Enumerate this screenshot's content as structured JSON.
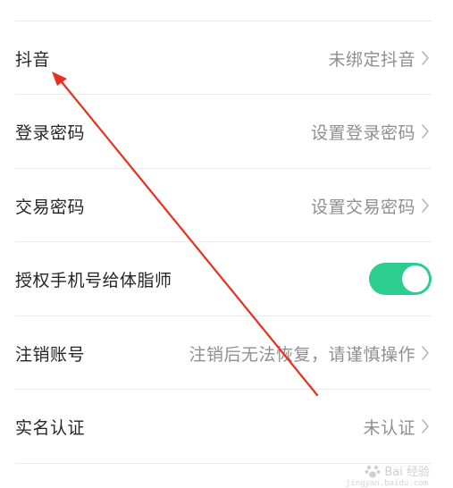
{
  "settings": {
    "rows": [
      {
        "label": "抖音",
        "value": "未绑定抖音"
      },
      {
        "label": "登录密码",
        "value": "设置登录密码"
      },
      {
        "label": "交易密码",
        "value": "设置交易密码"
      },
      {
        "label": "授权手机号给体脂师",
        "toggle_on": true
      },
      {
        "label": "注销账号",
        "value": "注销后无法恢复，请谨慎操作"
      },
      {
        "label": "实名认证",
        "value": "未认证"
      }
    ]
  },
  "colors": {
    "toggle_on": "#2dcc8f",
    "annotation_arrow": "#e8301e",
    "text_primary": "#262626",
    "text_secondary": "#8f8f8f"
  },
  "watermark": {
    "brand": "Bai 经验",
    "url": "jingyan.baidu.com"
  }
}
